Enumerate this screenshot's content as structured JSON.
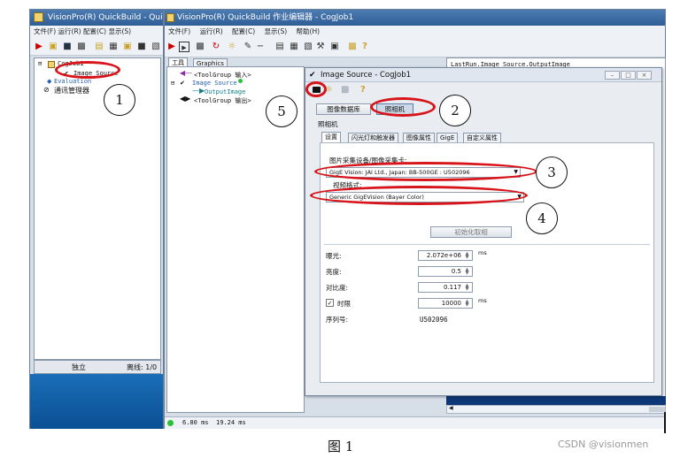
{
  "left_window": {
    "title": "VisionPro(R) QuickBuild - QuickBuild",
    "menu": "文件(F)  运行(R)  配置(C)  显示(S)",
    "tree": {
      "job": "CogJob1",
      "image_source": "Image Source",
      "node_partial": "Evaluation",
      "comm_manager": "通讯管理器"
    },
    "status": {
      "mode": "独立",
      "offline": "离线: 1/0"
    }
  },
  "editor_window": {
    "title": "VisionPro(R) QuickBuild 作业编辑器 - CogJob1",
    "menu": [
      "文件(F)",
      "运行(R)",
      "配置(C)",
      "显示(S)",
      "帮助(H)"
    ],
    "tabs": [
      "工具",
      "Graphics"
    ],
    "tree": {
      "input": "<ToolGroup 输入>",
      "image_source": "Image Source",
      "output_image": "OutputImage",
      "output": "<ToolGroup 输出>"
    },
    "results_header": "LastRun.Image Source.OutputImage",
    "status": {
      "time1": "6.80 ms",
      "time2": "19.24 ms"
    }
  },
  "dialog": {
    "title": "Image Source - CogJob1",
    "source_buttons": {
      "database": "图像数据库",
      "camera": "照相机"
    },
    "group_label": "照相机",
    "tabs": [
      "设置",
      "闪光灯和触发器",
      "图像属性",
      "GigE",
      "自定义属性"
    ],
    "device_label": "图片采集设备/图像采集卡:",
    "device_value": "GigE Vision: JAI Ltd., Japan: BB-500GE : U502096",
    "format_label": "视频格式:",
    "format_value": "Generic GigEVision (Bayer Color)",
    "init_button": "初始化取相",
    "fields": [
      {
        "label": "曝光:",
        "value": "2.072e+06",
        "unit": "ms"
      },
      {
        "label": "亮度:",
        "value": "0.5",
        "unit": ""
      },
      {
        "label": "对比度:",
        "value": "0.117",
        "unit": ""
      },
      {
        "label": "时限",
        "value": "10000",
        "unit": "ms",
        "checkbox": true
      }
    ],
    "serial_label": "序列号:",
    "serial_value": "U502096"
  },
  "annotations": [
    "1",
    "2",
    "3",
    "4",
    "5"
  ],
  "caption": "图 1",
  "watermark": "CSDN @visionmen",
  "colors": {
    "annotation_red": "#d8141b",
    "titlebar_blue": "#2f5e97"
  }
}
